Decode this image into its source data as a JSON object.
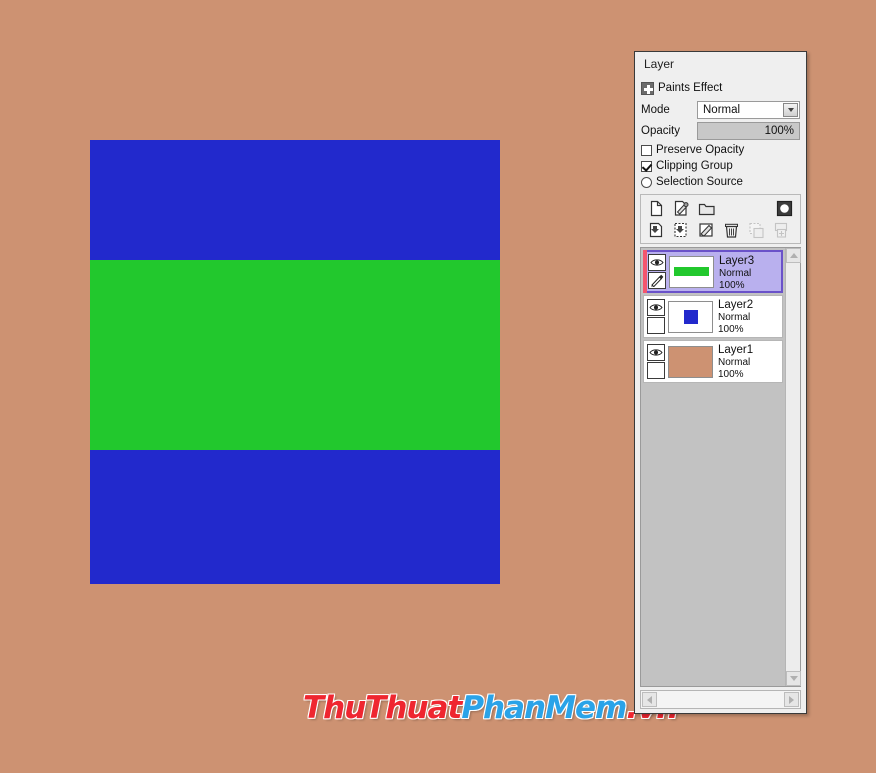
{
  "app": {
    "background_color": "#cd9272"
  },
  "canvas": {
    "name": "artwork-canvas",
    "base_color": "#2229cc",
    "band_color": "#22c82d"
  },
  "watermark": {
    "part1": "ThuThuat",
    "part2": "PhanMem",
    "part3": ".vn",
    "color1": "#ef2630",
    "color2": "#2aa3e8"
  },
  "panel": {
    "title": "Layer",
    "paints_effect_label": "Paints Effect",
    "mode": {
      "label": "Mode",
      "value": "Normal"
    },
    "opacity": {
      "label": "Opacity",
      "value": "100%"
    },
    "checkboxes": [
      {
        "label": "Preserve Opacity",
        "checked": false,
        "type": "checkbox"
      },
      {
        "label": "Clipping Group",
        "checked": true,
        "type": "checkbox"
      },
      {
        "label": "Selection Source",
        "checked": false,
        "type": "radio"
      }
    ],
    "toolbar": {
      "row1": [
        {
          "icon": "new-layer-icon",
          "enabled": true
        },
        {
          "icon": "new-paint-layer-icon",
          "enabled": true
        },
        {
          "icon": "new-folder-icon",
          "enabled": true
        },
        {
          "icon": "layer-mask-icon",
          "enabled": true
        }
      ],
      "row2": [
        {
          "icon": "merge-down-icon",
          "enabled": true
        },
        {
          "icon": "merge-selection-icon",
          "enabled": true
        },
        {
          "icon": "clear-layer-icon",
          "enabled": true
        },
        {
          "icon": "delete-layer-icon",
          "enabled": true
        },
        {
          "icon": "duplicate-selection-icon",
          "enabled": false
        },
        {
          "icon": "duplicate-layer-icon",
          "enabled": false
        }
      ]
    },
    "layers": [
      {
        "name": "Layer3",
        "mode": "Normal",
        "opacity": "100%",
        "selected": true,
        "visible": true,
        "thumb": "green-stripe",
        "thumb_color": "#22c82d"
      },
      {
        "name": "Layer2",
        "mode": "Normal",
        "opacity": "100%",
        "selected": false,
        "visible": true,
        "thumb": "blue-square",
        "thumb_color": "#2229cc"
      },
      {
        "name": "Layer1",
        "mode": "Normal",
        "opacity": "100%",
        "selected": false,
        "visible": true,
        "thumb": "tan-fill",
        "thumb_color": "#cd9272"
      }
    ]
  }
}
